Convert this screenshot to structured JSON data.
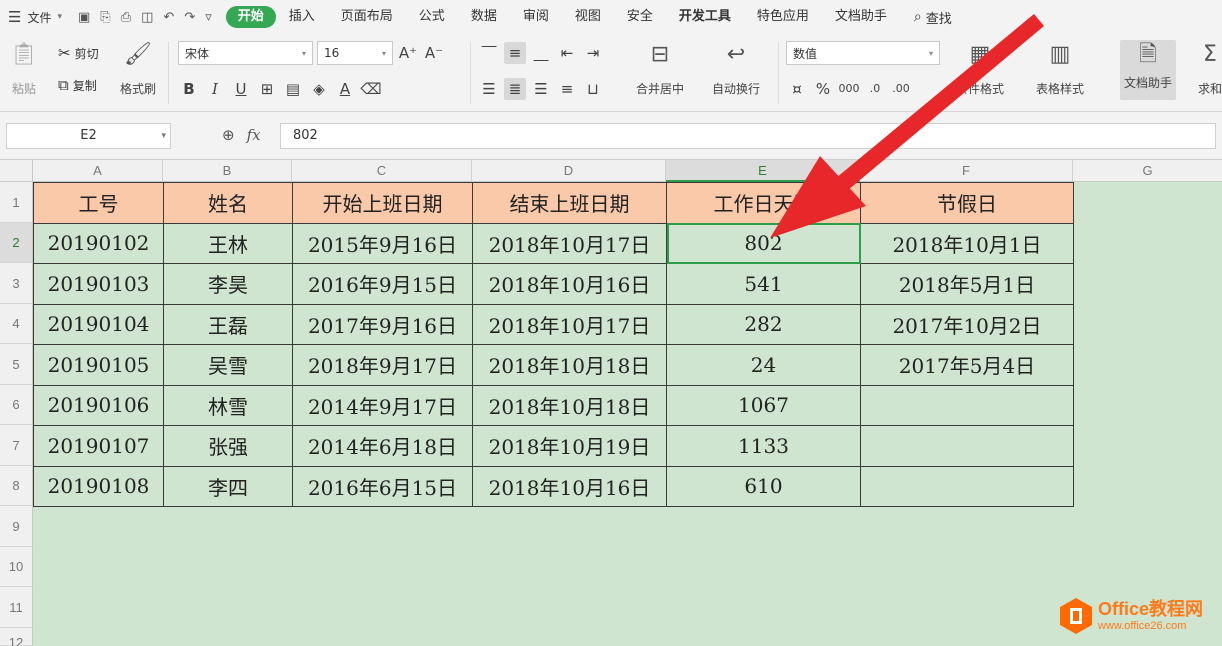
{
  "menubar": {
    "file_label": "文件",
    "tabs": [
      {
        "label": "开始",
        "active": true
      },
      {
        "label": "插入"
      },
      {
        "label": "页面布局"
      },
      {
        "label": "公式"
      },
      {
        "label": "数据"
      },
      {
        "label": "审阅"
      },
      {
        "label": "视图"
      },
      {
        "label": "安全"
      },
      {
        "label": "开发工具"
      },
      {
        "label": "特色应用"
      },
      {
        "label": "文档助手"
      }
    ],
    "search_label": "查找"
  },
  "ribbon": {
    "paste_label": "粘贴",
    "cut_label": "剪切",
    "copy_label": "复制",
    "format_painter_label": "格式刷",
    "font_name": "宋体",
    "font_size": "16",
    "merge_label": "合并居中",
    "wrap_label": "自动换行",
    "number_format": "数值",
    "conditional_format_label": "条件格式",
    "table_style_label": "表格样式",
    "doc_assistant_label": "文档助手",
    "find_label": "求和"
  },
  "formula_bar": {
    "name_box": "E2",
    "fx_symbol": "fx",
    "value": "802"
  },
  "sheet": {
    "active_cell": "E2",
    "columns": [
      "A",
      "B",
      "C",
      "D",
      "E",
      "F",
      "G"
    ],
    "rows": [
      "1",
      "2",
      "3",
      "4",
      "5",
      "6",
      "7",
      "8",
      "9",
      "10",
      "11",
      "12"
    ],
    "header_row": [
      "工号",
      "姓名",
      "开始上班日期",
      "结束上班日期",
      "工作日天数",
      "节假日"
    ],
    "data_rows": [
      [
        "20190102",
        "王林",
        "2015年9月16日",
        "2018年10月17日",
        "802",
        "2018年10月1日"
      ],
      [
        "20190103",
        "李昊",
        "2016年9月15日",
        "2018年10月16日",
        "541",
        "2018年5月1日"
      ],
      [
        "20190104",
        "王磊",
        "2017年9月16日",
        "2018年10月17日",
        "282",
        "2017年10月2日"
      ],
      [
        "20190105",
        "吴雪",
        "2018年9月17日",
        "2018年10月18日",
        "24",
        "2017年5月4日"
      ],
      [
        "20190106",
        "林雪",
        "2014年9月17日",
        "2018年10月18日",
        "1067",
        ""
      ],
      [
        "20190107",
        "张强",
        "2014年6月18日",
        "2018年10月19日",
        "1133",
        ""
      ],
      [
        "20190108",
        "李四",
        "2016年6月15日",
        "2018年10月16日",
        "610",
        ""
      ]
    ]
  },
  "colors": {
    "sheet_background": "#cfe5cf",
    "header_fill": "#f9c9a9",
    "selection": "#2e9e4a",
    "arrow": "#e8272a",
    "active_tab": "#34a853"
  },
  "watermark": {
    "brand": "Office教程网",
    "url": "www.office26.com"
  }
}
